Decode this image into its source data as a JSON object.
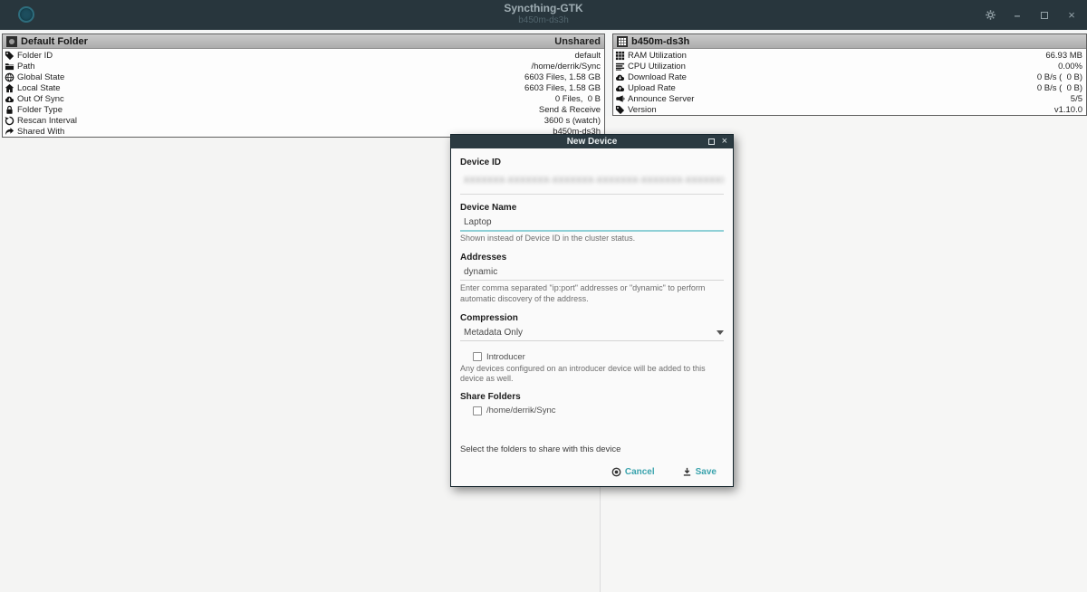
{
  "colors": {
    "titlebar_bg": "#28363d",
    "dialog_titlebar_bg": "#2b3a41",
    "panel_header_bg": "#b8b8b8",
    "accent_teal": "#3aa3ad",
    "input_focus_underline": "#8fd0d6"
  },
  "window": {
    "title": "Syncthing-GTK",
    "subtitle": "b450m-ds3h",
    "controls": {
      "settings": "gear-icon",
      "minimize": "minimize-icon",
      "restore": "restore-icon",
      "close": "close-icon"
    }
  },
  "panels": {
    "folder": {
      "title": "Default Folder",
      "status": "Unshared",
      "rows": [
        {
          "icon": "tag-icon",
          "label": "Folder ID",
          "value": "default"
        },
        {
          "icon": "folder-icon",
          "label": "Path",
          "value": "/home/derrik/Sync"
        },
        {
          "icon": "globe-icon",
          "label": "Global State",
          "value": "6603 Files, 1.58 GB"
        },
        {
          "icon": "home-icon",
          "label": "Local State",
          "value": "6603 Files, 1.58 GB"
        },
        {
          "icon": "cloud-down-icon",
          "label": "Out Of Sync",
          "value": "0 Files,  0 B"
        },
        {
          "icon": "lock-icon",
          "label": "Folder Type",
          "value": "Send & Receive"
        },
        {
          "icon": "refresh-icon",
          "label": "Rescan Interval",
          "value": "3600 s (watch)"
        },
        {
          "icon": "share-icon",
          "label": "Shared With",
          "value": "b450m-ds3h"
        }
      ]
    },
    "device": {
      "title": "b450m-ds3h",
      "rows": [
        {
          "icon": "ram-grid-icon",
          "label": "RAM Utilization",
          "value": "66.93 MB"
        },
        {
          "icon": "cpu-bars-icon",
          "label": "CPU Utilization",
          "value": "0.00%"
        },
        {
          "icon": "cloud-down-icon",
          "label": "Download Rate",
          "value": "0 B/s (  0 B)"
        },
        {
          "icon": "cloud-up-icon",
          "label": "Upload Rate",
          "value": "0 B/s (  0 B)"
        },
        {
          "icon": "megaphone-icon",
          "label": "Announce Server",
          "value": "5/5"
        },
        {
          "icon": "tag-icon",
          "label": "Version",
          "value": "v1.10.0"
        }
      ]
    }
  },
  "dialog": {
    "title": "New Device",
    "device_id": {
      "label": "Device ID",
      "value_redacted": "XXXXXXX-XXXXXXX-XXXXXXX-XXXXXXX-XXXXXXX-XXXXXXX-XXXXXXX-X"
    },
    "device_name": {
      "label": "Device Name",
      "value": "Laptop",
      "help": "Shown instead of Device ID in the cluster status."
    },
    "addresses": {
      "label": "Addresses",
      "value": "dynamic",
      "help": "Enter comma separated \"ip:port\" addresses or \"dynamic\" to perform automatic discovery of the address."
    },
    "compression": {
      "label": "Compression",
      "value": "Metadata Only"
    },
    "introducer": {
      "label": "Introducer",
      "checked": false,
      "help": "Any devices configured on an introducer device will be added to this device as well."
    },
    "share_folders": {
      "label": "Share Folders",
      "options": [
        {
          "label": "/home/derrik/Sync",
          "checked": false
        }
      ]
    },
    "footer": {
      "hint": "Select the folders to share with this device",
      "cancel": "Cancel",
      "save": "Save"
    }
  }
}
